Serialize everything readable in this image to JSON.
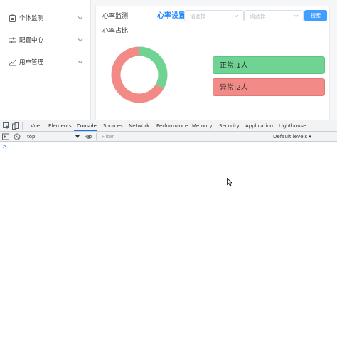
{
  "sidebar": {
    "items": [
      {
        "label": "个体监测",
        "icon": "clipboard-icon"
      },
      {
        "label": "配置中心",
        "icon": "sliders-icon"
      },
      {
        "label": "用户管理",
        "icon": "chart-line-icon"
      }
    ]
  },
  "header": {
    "tab_monitor": "心率监测",
    "tab_setting": "心率设置",
    "select1_placeholder": "请选择",
    "select2_placeholder": "请选择",
    "search_label": "搜索"
  },
  "section": {
    "title": "心率占比"
  },
  "chart_data": {
    "type": "pie",
    "categories": [
      "正常",
      "异常"
    ],
    "values": [
      1,
      2
    ],
    "colors": [
      "#6fd394",
      "#f28b87"
    ]
  },
  "legend": {
    "normal": "正常:1人",
    "abnormal": "异常:2人"
  },
  "devtools": {
    "tabs": [
      "Vue",
      "Elements",
      "Console",
      "Sources",
      "Network",
      "Performance",
      "Memory",
      "Security",
      "Application",
      "Lighthouse"
    ],
    "active_tab": "Console",
    "context": "top",
    "filter_placeholder": "Filter",
    "levels": "Default levels",
    "prompt": ">"
  }
}
